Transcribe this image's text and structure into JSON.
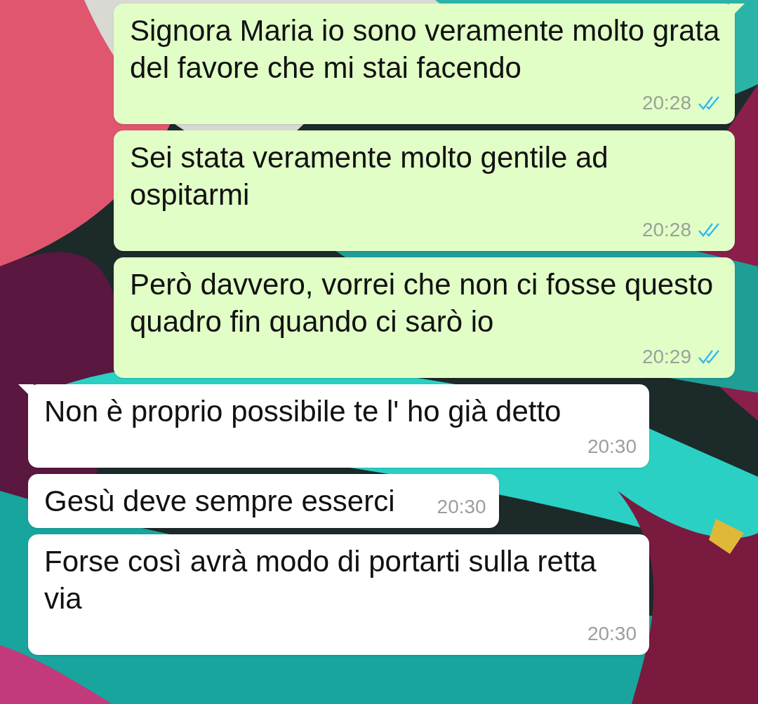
{
  "messages": [
    {
      "kind": "out",
      "text": "Signora Maria io sono veramente molto grata del favore che mi stai facendo",
      "time": "20:28",
      "read": true,
      "tail": true
    },
    {
      "kind": "out",
      "text": "Sei stata veramente molto gentile ad ospitarmi",
      "time": "20:28",
      "read": true,
      "tail": false
    },
    {
      "kind": "out",
      "text": "Però davvero, vorrei che non ci fosse questo quadro fin quando ci sarò io",
      "time": "20:29",
      "read": true,
      "tail": false
    },
    {
      "kind": "in",
      "text": "Non è proprio possibile te l' ho già detto",
      "time": "20:30",
      "tail": true
    },
    {
      "kind": "in",
      "text": "Gesù deve sempre esserci",
      "time": "20:30",
      "tail": false
    },
    {
      "kind": "in",
      "text": "Forse così avrà modo di portarti sulla retta via",
      "time": "20:30",
      "tail": false
    }
  ]
}
